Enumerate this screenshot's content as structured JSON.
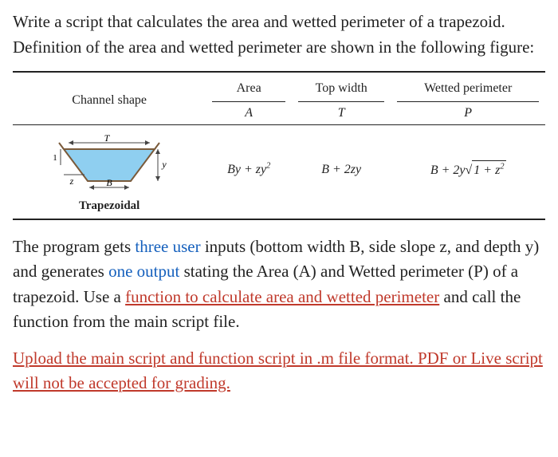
{
  "para1": {
    "t1": "Write a script that calculates the area and wetted perimeter of a trapezoid. Definition of the area and wetted perimeter are shown in the following figure:"
  },
  "table": {
    "headers": {
      "shape": "Channel shape",
      "area": {
        "hdr": "Area",
        "sub": "A"
      },
      "topwidth": {
        "hdr": "Top width",
        "sub": "T"
      },
      "wetted": {
        "hdr": "Wetted perimeter",
        "sub": "P"
      }
    },
    "row": {
      "shape_label": "Trapezoidal",
      "area_formula": "By + zy",
      "area_sup": "2",
      "topwidth_formula": "B + 2zy",
      "wetted_prefix": "B + 2y",
      "wetted_sqrt_body": "1 + z",
      "wetted_sqrt_sup": "2"
    },
    "diagram": {
      "T": "T",
      "B": "B",
      "y": "y",
      "z": "z",
      "one": "1"
    }
  },
  "para2": {
    "t1": "The program gets ",
    "blue1": "three user",
    "t2": " inputs (bottom width B, side slope z, and depth y) and generates ",
    "blue2": "one output",
    "t3": " stating the Area (A) and Wetted perimeter (P) of a trapezoid. Use a ",
    "red1": "function to calculate area and wetted perimeter",
    "t4": " and call the function from the main script file."
  },
  "para3": {
    "red1": "Upload the main script and function script in .m file format. PDF or Live script will not be accepted for grading."
  }
}
